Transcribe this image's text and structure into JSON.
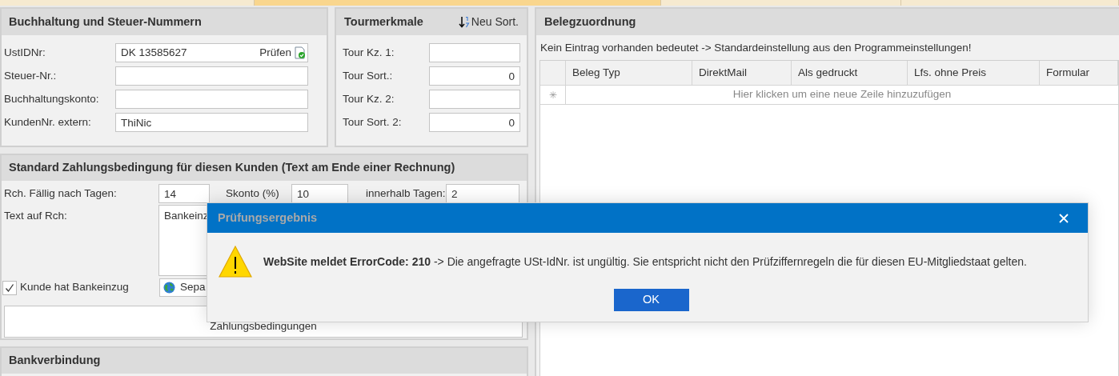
{
  "tabs": [
    {
      "selected": false
    },
    {
      "selected": true
    },
    {
      "selected": false
    },
    {
      "selected": false
    }
  ],
  "accounting": {
    "title": "Buchhaltung und Steuer-Nummern",
    "fields": [
      {
        "label": "UstIDNr:",
        "value": "DK 13585627",
        "action": "Prüfen"
      },
      {
        "label": "Steuer-Nr.:"
      },
      {
        "label": "Buchhaltungskonto:"
      },
      {
        "label": "KundenNr. extern:",
        "value": "ThiNic"
      }
    ]
  },
  "tour": {
    "title": "Tourmerkmale",
    "sort_button": "Neu Sort.",
    "fields": [
      {
        "label": "Tour Kz. 1:",
        "kind": "text"
      },
      {
        "label": "Tour Sort.:",
        "value": "0",
        "kind": "number"
      },
      {
        "label": "Tour Kz. 2:",
        "kind": "text"
      },
      {
        "label": "Tour Sort. 2:",
        "value": "0",
        "kind": "number"
      }
    ]
  },
  "payment": {
    "title": "Standard Zahlungsbedingung für diesen Kunden (Text am Ende einer Rechnung)",
    "due_label": "Rch. Fällig nach Tagen:",
    "due_value": "14",
    "discount_label": "Skonto (%)",
    "discount_value": "10",
    "within_label": "innerhalb Tagen:",
    "within_value": "2",
    "text_label": "Text auf Rch:",
    "text_value": "Bankeinz",
    "direct_debit": {
      "label": "Kunde hat Bankeinzug",
      "checked": true
    },
    "sepa_button": "Sepa",
    "terms_button": "Zahlungsbedingungen"
  },
  "bank": {
    "title": "Bankverbindung"
  },
  "documents": {
    "title": "Belegzuordnung",
    "info": "Kein Eintrag vorhanden bedeutet -> Standardeinstellung aus den Programmeinstellungen!",
    "columns": [
      "Beleg Typ",
      "DirektMail",
      "Als gedruckt",
      "Lfs. ohne Preis",
      "Formular"
    ],
    "new_row_marker": "✳",
    "new_row_hint": "Hier klicken um eine neue Zeile hinzuzufügen"
  },
  "dialog": {
    "title": "Prüfungsergebnis",
    "message": "**WebSite meldet ErrorCode: 210** -> Die angefragte USt-IdNr. ist ungültig. Sie entspricht nicht den Prüfziffernregeln die für diesen EU-Mitgliedstaat gelten.",
    "ok_button": "OK"
  }
}
